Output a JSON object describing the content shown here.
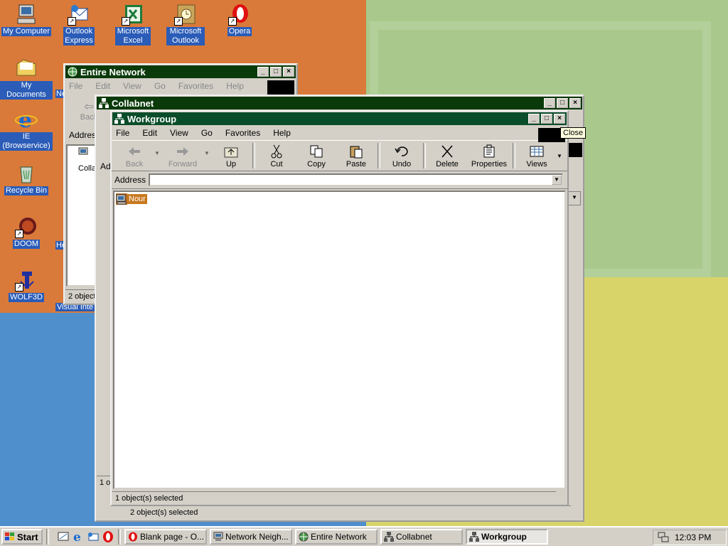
{
  "desktop": {
    "icons": [
      {
        "label": "My Computer",
        "icon": "my-computer-icon"
      },
      {
        "label": "Outlook Express",
        "icon": "outlook-express-icon"
      },
      {
        "label": "Microsoft Excel",
        "icon": "excel-icon"
      },
      {
        "label": "Microsoft Outlook",
        "icon": "outlook-icon"
      },
      {
        "label": "Opera",
        "icon": "opera-icon"
      },
      {
        "label": "My Documents",
        "icon": "folder-icon"
      },
      {
        "label": "IE (Browservice)",
        "icon": "internet-explorer-icon"
      },
      {
        "label": "Recycle Bin",
        "icon": "recycle-bin-icon"
      },
      {
        "label": "DOOM",
        "icon": "doom-icon"
      },
      {
        "label": "WOLF3D",
        "icon": "wolf3d-icon"
      },
      {
        "label": "Visual Inte",
        "icon": "partial"
      },
      {
        "label": "He",
        "icon": "partial"
      },
      {
        "label": "Ne",
        "icon": "partial"
      }
    ]
  },
  "windows": {
    "entire_network": {
      "title": "Entire Network",
      "menu": [
        "File",
        "Edit",
        "View",
        "Go",
        "Favorites",
        "Help"
      ],
      "back_label": "Back",
      "address_label": "Addres",
      "item_label": "Colla",
      "status": "2 object"
    },
    "collabnet": {
      "title": "Collabnet",
      "address_label": "Ad",
      "status": "1 ol",
      "bottom_status": "2 object(s) selected"
    },
    "workgroup": {
      "title": "Workgroup",
      "menu": [
        "File",
        "Edit",
        "View",
        "Go",
        "Favorites",
        "Help"
      ],
      "toolbar": {
        "back": "Back",
        "forward": "Forward",
        "up": "Up",
        "cut": "Cut",
        "copy": "Copy",
        "paste": "Paste",
        "undo": "Undo",
        "delete": "Delete",
        "properties": "Properties",
        "views": "Views"
      },
      "address_label": "Address",
      "address_value": "",
      "items": [
        {
          "label": "Nour",
          "icon": "computer-icon"
        }
      ],
      "status": "1 object(s) selected"
    }
  },
  "tooltip": "Close",
  "taskbar": {
    "start_label": "Start",
    "tasks": [
      {
        "label": "Blank page - O...",
        "icon": "opera-icon"
      },
      {
        "label": "Network Neigh...",
        "icon": "network-icon"
      },
      {
        "label": "Entire Network",
        "icon": "globe-icon"
      },
      {
        "label": "Collabnet",
        "icon": "network-icon"
      },
      {
        "label": "Workgroup",
        "icon": "network-icon",
        "active": true
      }
    ],
    "clock": "12:03 PM"
  },
  "colors": {
    "title_active": "#0a4d2a",
    "title_inactive": "#0a3a0a",
    "chrome": "#d4d0c8",
    "desktop_label_bg": "#2a5cb8"
  }
}
